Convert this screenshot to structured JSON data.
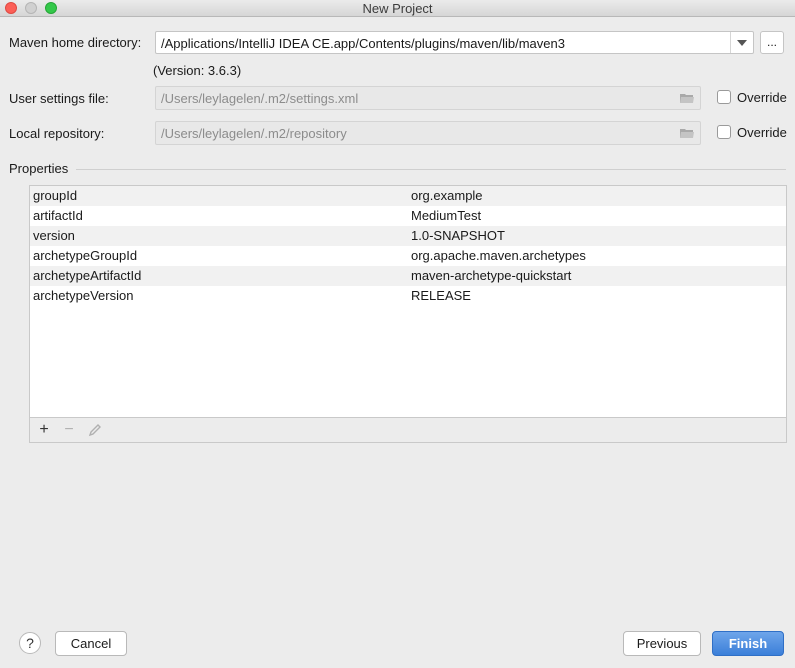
{
  "window": {
    "title": "New Project"
  },
  "maven": {
    "home_label": "Maven home directory:",
    "home_value": "/Applications/IntelliJ IDEA CE.app/Contents/plugins/maven/lib/maven3",
    "browse_label": "...",
    "version": "(Version: 3.6.3)",
    "settings_label": "User settings file:",
    "settings_value": "/Users/leylagelen/.m2/settings.xml",
    "repo_label": "Local repository:",
    "repo_value": "/Users/leylagelen/.m2/repository",
    "override_label": "Override"
  },
  "properties": {
    "title": "Properties",
    "rows": [
      {
        "key": "groupId",
        "value": "org.example"
      },
      {
        "key": "artifactId",
        "value": "MediumTest"
      },
      {
        "key": "version",
        "value": "1.0-SNAPSHOT"
      },
      {
        "key": "archetypeGroupId",
        "value": "org.apache.maven.archetypes"
      },
      {
        "key": "archetypeArtifactId",
        "value": "maven-archetype-quickstart"
      },
      {
        "key": "archetypeVersion",
        "value": "RELEASE"
      }
    ],
    "toolbar": {
      "add": "+",
      "remove": "−"
    }
  },
  "footer": {
    "help": "?",
    "cancel": "Cancel",
    "previous": "Previous",
    "finish": "Finish"
  }
}
